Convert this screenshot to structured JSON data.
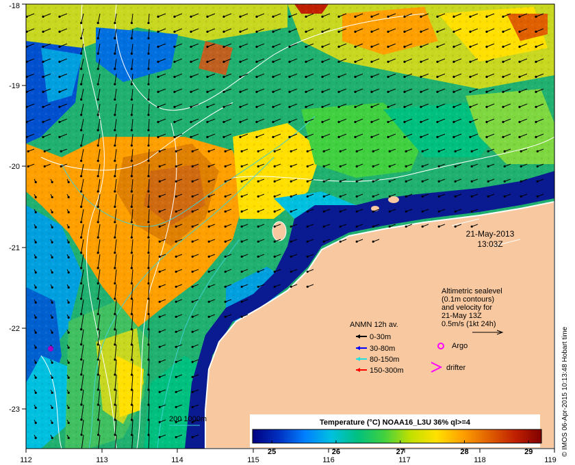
{
  "map": {
    "date": "21-May-2013",
    "time": "13:03Z",
    "lon_ticks": [
      "112",
      "113",
      "114",
      "115",
      "116",
      "117",
      "118",
      "119"
    ],
    "lat_ticks": [
      "-18",
      "-19",
      "-20",
      "-21",
      "-22",
      "-23"
    ],
    "credit": "© IMOS 06-Apr-2015 10:13:48 Hobart time",
    "colors": {
      "land": "#f8c9a0",
      "frame": "#000000",
      "contour": "#ffffff",
      "isobath": "#40d0d0"
    }
  },
  "altimetry": {
    "line1": "Altimetric sealevel",
    "line2": "(0.1m contours)",
    "line3": "and velocity for",
    "line4": "21-May 13Z",
    "line5": "0.5m/s (1kt 24h)"
  },
  "anmn_legend": {
    "title": "ANMN 12h av.",
    "items": [
      {
        "label": "0-30m",
        "color": "#000000"
      },
      {
        "label": "30-80m",
        "color": "#0000ff"
      },
      {
        "label": "80-150m",
        "color": "#20e0e0"
      },
      {
        "label": "150-300m",
        "color": "#ff0000"
      }
    ]
  },
  "symbol_legend": {
    "argo": "Argo",
    "drifter": "drifter",
    "argo_color": "#ff00ff",
    "drifter_color": "#ff00ff"
  },
  "isobath_legend": {
    "label": "200 1000m"
  },
  "colorbar": {
    "title": "Temperature (°C) NOAA16_L3U 36% ql>=4",
    "ticks": [
      "25",
      "26",
      "27",
      "28",
      "29"
    ],
    "range": [
      24.7,
      29.2
    ],
    "stops": [
      "#000080",
      "#0030c0",
      "#0080ff",
      "#00c0e0",
      "#00c080",
      "#40d040",
      "#c0e000",
      "#ffe000",
      "#ffa000",
      "#e06000",
      "#c02000",
      "#800000"
    ]
  }
}
